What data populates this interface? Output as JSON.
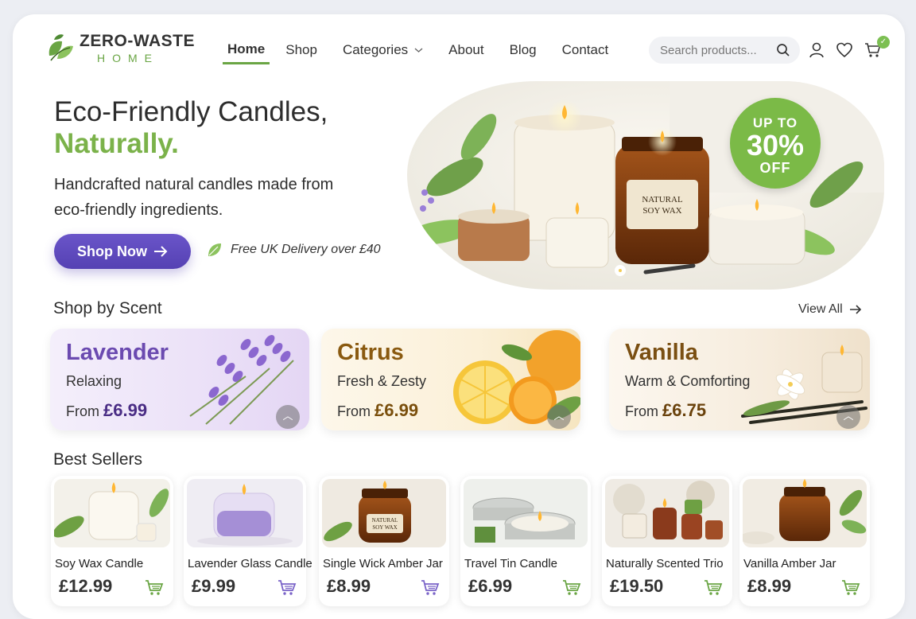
{
  "brand": {
    "title": "ZERO-WASTE",
    "subtitle": "HOME"
  },
  "nav": {
    "items": [
      {
        "label": "Home"
      },
      {
        "label": "Shop"
      },
      {
        "label": "Categories"
      },
      {
        "label": "About"
      },
      {
        "label": "Blog"
      },
      {
        "label": "Contact"
      }
    ]
  },
  "search": {
    "placeholder": "Search products..."
  },
  "hero": {
    "title_line1": "Eco-Friendly Candles,",
    "title_line2": "Naturally.",
    "subtitle": "Handcrafted natural candles made from eco-friendly ingredients.",
    "cta_label": "Shop Now",
    "delivery_note": "Free UK Delivery over £40",
    "jar_label": "NATURAL SOY WAX",
    "promo": {
      "line1": "UP TO",
      "line2": "30%",
      "line3": "OFF"
    }
  },
  "scents": {
    "title": "Shop by Scent",
    "view_all": "View All",
    "items": [
      {
        "name": "Lavender",
        "desc": "Relaxing",
        "from": "From",
        "price": "£6.99"
      },
      {
        "name": "Citrus",
        "desc": "Fresh & Zesty",
        "from": "From",
        "price": "£6.99"
      },
      {
        "name": "Vanilla",
        "desc": "Warm & Comforting",
        "from": "From",
        "price": "£6.75"
      }
    ]
  },
  "best_sellers": {
    "title": "Best Sellers",
    "items": [
      {
        "name": "Soy Wax Candle",
        "price": "£12.99"
      },
      {
        "name": "Lavender Glass Candle",
        "price": "£9.99"
      },
      {
        "name": "Single Wick Amber Jar",
        "price": "£8.99"
      },
      {
        "name": "Travel Tin Candle",
        "price": "£6.99"
      },
      {
        "name": "Naturally Scented Trio",
        "price": "£19.50"
      },
      {
        "name": "Vanilla Amber Jar",
        "price": "£8.99"
      }
    ]
  },
  "colors": {
    "accent_green": "#7bb24a",
    "accent_purple": "#5b47b8",
    "lavender_text": "#6b4ab0",
    "citrus_text": "#8a5a10",
    "vanilla_text": "#7a4f12"
  }
}
